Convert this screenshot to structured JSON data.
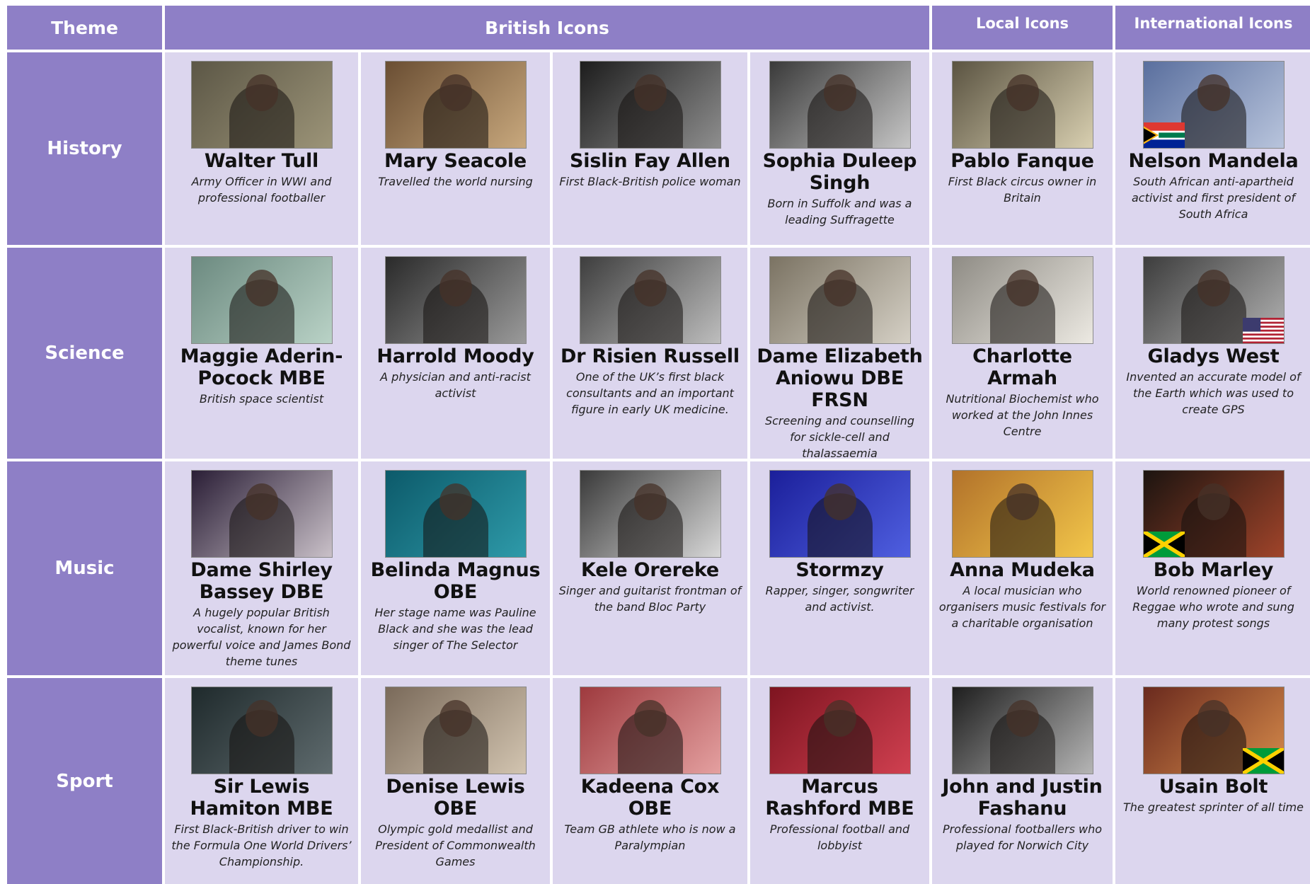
{
  "header": {
    "theme": "Theme",
    "british": "British Icons",
    "local": "Local Icons",
    "international": "International Icons"
  },
  "rows": [
    {
      "theme": "History",
      "people": [
        {
          "name": "Walter Tull",
          "desc": "Army Officer in WWI and professional footballer",
          "tone": [
            "#5c5746",
            "#9c9478"
          ]
        },
        {
          "name": "Mary Seacole",
          "desc": "Travelled the world nursing",
          "tone": [
            "#6a4e33",
            "#c8a87d"
          ]
        },
        {
          "name": "Sislin Fay Allen",
          "desc": "First Black-British police woman",
          "tone": [
            "#1d1d1d",
            "#8e8e8e"
          ]
        },
        {
          "name": "Sophia Duleep Singh",
          "desc": "Born in Suffolk and was a leading Suffragette",
          "tone": [
            "#3a3a3a",
            "#c6c6c6"
          ]
        },
        {
          "name": "Pablo Fanque",
          "desc": "First Black circus owner in Britain",
          "tone": [
            "#5b5442",
            "#d8cfb0"
          ]
        },
        {
          "name": "Nelson Mandela",
          "desc": "South African anti-apartheid activist and first president of South Africa",
          "tone": [
            "#5a6f9e",
            "#b8c4dc"
          ],
          "flag": "za",
          "flagSide": "left"
        }
      ]
    },
    {
      "theme": "Science",
      "people": [
        {
          "name": "Maggie Aderin-Pocock MBE",
          "desc": "British space scientist",
          "tone": [
            "#6c8a80",
            "#b9d2c6"
          ]
        },
        {
          "name": "Harrold Moody",
          "desc": "A physician and anti-racist activist",
          "tone": [
            "#2a2a2a",
            "#9a9a9a"
          ]
        },
        {
          "name": "Dr Risien Russell",
          "desc": "One of the UK’s first black consultants and an important figure in early UK medicine.",
          "tone": [
            "#3e3e3e",
            "#bdbdbd"
          ]
        },
        {
          "name": "Dame Elizabeth Aniowu DBE FRSN",
          "desc": "Screening and counselling for sickle-cell and thalassaemia",
          "tone": [
            "#7b7363",
            "#d5d0c5"
          ]
        },
        {
          "name": "Charlotte Armah",
          "desc": "Nutritional Biochemist who worked at the John Innes Centre",
          "tone": [
            "#8f8c85",
            "#ece9e2"
          ]
        },
        {
          "name": "Gladys West",
          "desc": "Invented an accurate model of the Earth which was used to create GPS",
          "tone": [
            "#3d3d3d",
            "#b3b3b3"
          ],
          "flag": "us",
          "flagSide": "right"
        }
      ]
    },
    {
      "theme": "Music",
      "people": [
        {
          "name": "Dame Shirley Bassey DBE",
          "desc": "A hugely popular British vocalist, known for her powerful voice and James Bond theme tunes",
          "tone": [
            "#2a1e36",
            "#c9c0c8"
          ]
        },
        {
          "name": "Belinda Magnus OBE",
          "desc": "Her stage name was Pauline Black and she was the lead singer of The Selector",
          "tone": [
            "#0c5a6a",
            "#2e9aa9"
          ]
        },
        {
          "name": "Kele Orereke",
          "desc": "Singer and guitarist frontman of the band Bloc Party",
          "tone": [
            "#3a3a3a",
            "#d8d8d8"
          ]
        },
        {
          "name": "Stormzy",
          "desc": "Rapper, singer, songwriter and activist.",
          "tone": [
            "#1b1f9a",
            "#4f5fe0"
          ]
        },
        {
          "name": "Anna Mudeka",
          "desc": "A local musician who organisers music festivals for a charitable organisation",
          "tone": [
            "#b2722a",
            "#f2c64a"
          ]
        },
        {
          "name": "Bob Marley",
          "desc": "World renowned pioneer of Reggae who wrote and sung many protest songs",
          "tone": [
            "#1c1410",
            "#a0442a"
          ],
          "flag": "jm",
          "flagSide": "left"
        }
      ]
    },
    {
      "theme": "Sport",
      "people": [
        {
          "name": "Sir Lewis Hamiton MBE",
          "desc": "First Black-British driver to win the Formula One World Drivers’ Championship.",
          "tone": [
            "#1f2a2c",
            "#5f6b6e"
          ]
        },
        {
          "name": "Denise Lewis OBE",
          "desc": "Olympic gold medallist and President of Commonwealth Games",
          "tone": [
            "#7a6a5a",
            "#d2c4b0"
          ]
        },
        {
          "name": "Kadeena Cox OBE",
          "desc": "Team GB athlete who is now a Paralympian",
          "tone": [
            "#9e3a3e",
            "#e4a0a0"
          ]
        },
        {
          "name": "Marcus Rashford MBE",
          "desc": "Professional football and lobbyist",
          "tone": [
            "#7e1420",
            "#d04050"
          ]
        },
        {
          "name": "John and Justin Fashanu",
          "desc": "Professional footballers who played for Norwich City",
          "tone": [
            "#1e1e1e",
            "#b5b5b5"
          ]
        },
        {
          "name": "Usain Bolt",
          "desc": "The greatest sprinter of all time",
          "tone": [
            "#6a2a1e",
            "#d68a4a"
          ],
          "flag": "jm",
          "flagSide": "right"
        }
      ]
    }
  ]
}
